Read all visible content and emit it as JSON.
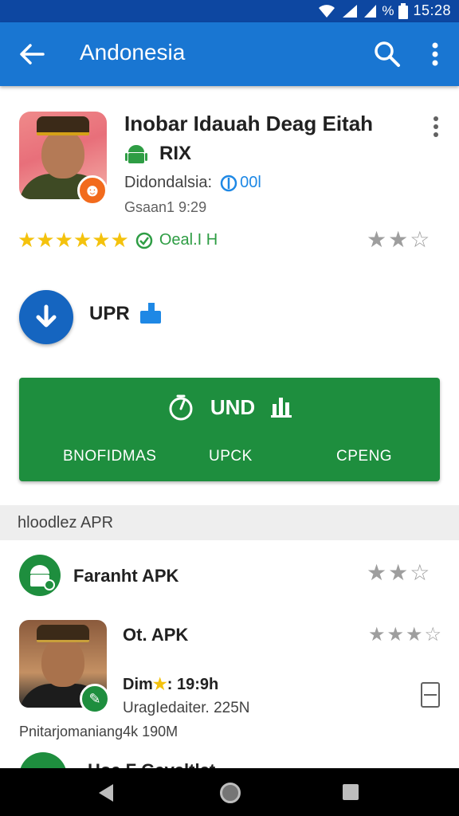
{
  "status_bar": {
    "time": "15:28",
    "battery_text": "%"
  },
  "app_bar": {
    "title": "Andonesia"
  },
  "app": {
    "name": "Inobar Idauah Deag Eitah",
    "platform_label": "RIX",
    "meta_label": "Didondalsia:",
    "meta_tag": "00l",
    "version_line": "Gsaan1 9:29",
    "rating_label": "Oeal.I H",
    "left_stars": "★★★★★★",
    "right_stars": {
      "filled": "★★",
      "empty": "☆"
    }
  },
  "download": {
    "label": "UPR"
  },
  "action_card": {
    "title": "UND",
    "buttons": [
      "BNOFIDMAS",
      "UPCK",
      "CPENG"
    ],
    "color": "#1e8e3e"
  },
  "section": {
    "title": "hloodlez APR"
  },
  "list": [
    {
      "title": "Faranht APK",
      "stars_filled": "★★",
      "stars_empty": "☆"
    },
    {
      "title": "Ot. APK",
      "stars_filled": "★★★",
      "stars_empty": "☆",
      "sub_prefix": "Dim",
      "sub_star": "★",
      "sub_value": ": 19:9h",
      "sub2": "UragI​edaiter. 225N",
      "size_line": "Pnitarjomaniang4k 190M"
    },
    {
      "title": "Hoa F Gaveltlet"
    }
  ],
  "colors": {
    "primary": "#1976d2",
    "status": "#0d47a1",
    "accent_green": "#1e8e3e",
    "star": "#f4c20d"
  }
}
